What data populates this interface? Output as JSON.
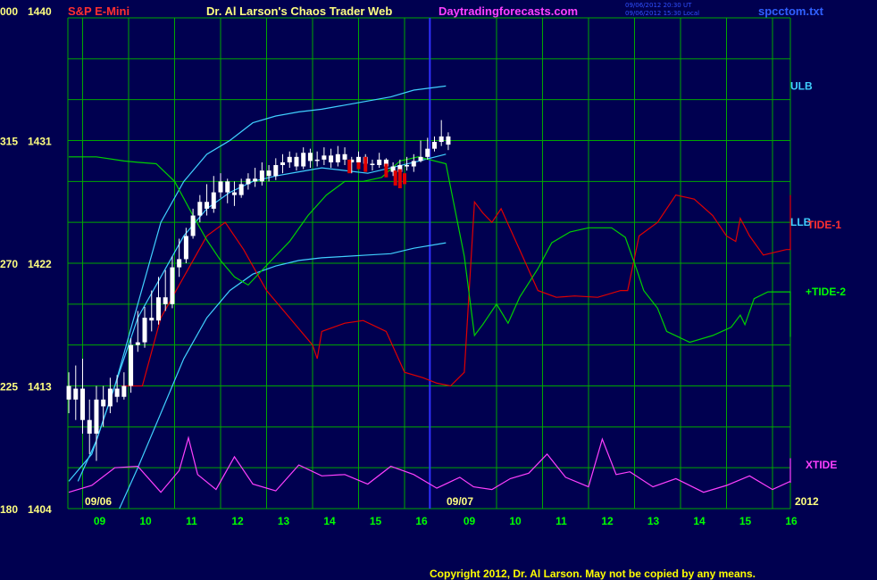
{
  "header": {
    "instrument": "S&P E-Mini",
    "title": "Dr. Al Larson's Chaos Trader Web",
    "website": "Daytradingforecasts.com",
    "stamp_line1": "09/06/2012 20:30 UT",
    "stamp_line2": "09/06/2012 15:30 Local",
    "file": "spcctom.txt"
  },
  "footer": {
    "copyright": "Copyright 2012, Dr. Al Larson. May not be copied by any means."
  },
  "colors": {
    "background": "#000050",
    "grid": "#00a800",
    "price": "#ffffff",
    "tide1": "#e00000",
    "tide2": "#00d000",
    "xtide": "#ff40ff",
    "bands": "#40d0ff",
    "day_divider": "#3030ff",
    "left_axis": "#ffff80",
    "hour_labels": "#00ff00"
  },
  "chart_data": {
    "type": "line",
    "title": "S&P E-Mini",
    "y_left_labels": [
      {
        "left": "000",
        "right": "1440"
      },
      {
        "left": "315",
        "right": "1431"
      },
      {
        "left": "270",
        "right": "1422"
      },
      {
        "left": "225",
        "right": "1413"
      },
      {
        "left": "180",
        "right": "1404"
      }
    ],
    "ylim": [
      1404,
      1440
    ],
    "x_hour_labels": [
      "09",
      "10",
      "11",
      "12",
      "13",
      "14",
      "15",
      "16",
      "09",
      "10",
      "11",
      "12",
      "13",
      "14",
      "15",
      "16"
    ],
    "date_labels": [
      "09/06",
      "09/07"
    ],
    "year_label": "2012",
    "series": [
      {
        "name": "ULB",
        "kind": "band-upper",
        "values": [
          [
            0,
            1406
          ],
          [
            0.5,
            1408
          ],
          [
            1,
            1413
          ],
          [
            1.5,
            1419
          ],
          [
            2,
            1425
          ],
          [
            2.5,
            1428
          ],
          [
            3,
            1430
          ],
          [
            3.5,
            1431
          ],
          [
            4,
            1432.3
          ],
          [
            4.5,
            1432.8
          ],
          [
            5,
            1433.1
          ],
          [
            5.5,
            1433.3
          ],
          [
            6,
            1433.6
          ],
          [
            6.5,
            1433.9
          ],
          [
            7,
            1434.2
          ],
          [
            7.5,
            1434.7
          ],
          [
            8.2,
            1435
          ]
        ]
      },
      {
        "name": "LLB",
        "kind": "band-lower",
        "values": [
          [
            1.1,
            1404
          ],
          [
            1.5,
            1407
          ],
          [
            2,
            1411
          ],
          [
            2.5,
            1415
          ],
          [
            3,
            1418
          ],
          [
            3.5,
            1420
          ],
          [
            4,
            1421.2
          ],
          [
            4.5,
            1421.8
          ],
          [
            5,
            1422.2
          ],
          [
            5.5,
            1422.4
          ],
          [
            6,
            1422.5
          ],
          [
            6.5,
            1422.6
          ],
          [
            7,
            1422.7
          ],
          [
            7.5,
            1423.1
          ],
          [
            8.2,
            1423.5
          ]
        ]
      },
      {
        "name": "mid-band",
        "kind": "band-mid",
        "values": [
          [
            0.2,
            1406
          ],
          [
            0.6,
            1409
          ],
          [
            1,
            1413
          ],
          [
            1.5,
            1418
          ],
          [
            2,
            1421
          ],
          [
            2.5,
            1424
          ],
          [
            3,
            1426
          ],
          [
            3.5,
            1427.2
          ],
          [
            4,
            1428
          ],
          [
            4.5,
            1428.4
          ],
          [
            5,
            1428.7
          ],
          [
            5.5,
            1429
          ],
          [
            6,
            1428.8
          ],
          [
            6.5,
            1428.6
          ],
          [
            7,
            1429
          ],
          [
            7.5,
            1429.4
          ],
          [
            8.2,
            1430
          ]
        ]
      },
      {
        "name": "TIDE-1",
        "values": [
          [
            1.15,
            1413
          ],
          [
            1.6,
            1413
          ],
          [
            2,
            1418
          ],
          [
            2.5,
            1421
          ],
          [
            3,
            1424
          ],
          [
            3.4,
            1425
          ],
          [
            3.8,
            1423
          ],
          [
            4.3,
            1420
          ],
          [
            4.8,
            1418
          ],
          [
            5.3,
            1416
          ],
          [
            5.4,
            1415
          ],
          [
            5.5,
            1417
          ],
          [
            6,
            1417.6
          ],
          [
            6.4,
            1417.8
          ],
          [
            6.9,
            1417
          ],
          [
            7.3,
            1414
          ],
          [
            7.7,
            1413.6
          ],
          [
            8.0,
            1413.2
          ],
          [
            8.3,
            1413
          ],
          [
            8.6,
            1414
          ],
          [
            8.82,
            1426.5
          ],
          [
            9,
            1425.7
          ],
          [
            9.2,
            1425
          ],
          [
            9.4,
            1426
          ],
          [
            9.8,
            1423
          ],
          [
            10.2,
            1420
          ],
          [
            10.6,
            1419.5
          ],
          [
            11,
            1419.6
          ],
          [
            11.5,
            1419.5
          ],
          [
            12,
            1420
          ],
          [
            12.15,
            1420
          ],
          [
            12.4,
            1424
          ],
          [
            12.8,
            1425
          ],
          [
            13.2,
            1427
          ],
          [
            13.6,
            1426.7
          ],
          [
            14,
            1425.5
          ],
          [
            14.3,
            1424
          ],
          [
            14.5,
            1423.6
          ],
          [
            14.6,
            1425.3
          ],
          [
            14.8,
            1424
          ],
          [
            15.1,
            1422.6
          ],
          [
            15.6,
            1423
          ],
          [
            16.2,
            1423
          ],
          [
            16.5,
            1423
          ],
          [
            16.7,
            1423.2
          ],
          [
            16.8,
            1425
          ],
          [
            17.3,
            1427
          ],
          [
            17.8,
            1425.3
          ]
        ]
      },
      {
        "name": "TIDE-2",
        "values": [
          [
            0,
            1429.8
          ],
          [
            0.6,
            1429.8
          ],
          [
            1.2,
            1429.5
          ],
          [
            1.5,
            1429.4
          ],
          [
            1.9,
            1429.3
          ],
          [
            2.3,
            1428
          ],
          [
            2.7,
            1425.5
          ],
          [
            3,
            1423.7
          ],
          [
            3.3,
            1422.2
          ],
          [
            3.6,
            1421
          ],
          [
            3.9,
            1420.4
          ],
          [
            4.4,
            1422.2
          ],
          [
            4.8,
            1423.6
          ],
          [
            5.2,
            1425.5
          ],
          [
            5.6,
            1427
          ],
          [
            6,
            1428
          ],
          [
            6.4,
            1428
          ],
          [
            6.8,
            1428.3
          ],
          [
            7.2,
            1429.5
          ],
          [
            7.6,
            1429.8
          ],
          [
            8.2,
            1429.3
          ],
          [
            8.6,
            1422.5
          ],
          [
            8.82,
            1416.7
          ],
          [
            9,
            1417.5
          ],
          [
            9.3,
            1419
          ],
          [
            9.55,
            1417.6
          ],
          [
            9.8,
            1419.5
          ],
          [
            10.2,
            1421.6
          ],
          [
            10.5,
            1423.5
          ],
          [
            10.9,
            1424.3
          ],
          [
            11.3,
            1424.6
          ],
          [
            11.8,
            1424.6
          ],
          [
            12.1,
            1423.9
          ],
          [
            12.35,
            1421.5
          ],
          [
            12.5,
            1420
          ],
          [
            12.8,
            1418.7
          ],
          [
            13,
            1417
          ],
          [
            13.5,
            1416.2
          ],
          [
            14,
            1416.7
          ],
          [
            14.4,
            1417.3
          ],
          [
            14.6,
            1418.2
          ],
          [
            14.7,
            1417.5
          ],
          [
            14.9,
            1419.4
          ],
          [
            15.2,
            1419.9
          ],
          [
            15.8,
            1419.9
          ],
          [
            16.2,
            1419.8
          ],
          [
            16.3,
            1417.6
          ],
          [
            16.6,
            1416.6
          ],
          [
            17,
            1417
          ],
          [
            17.4,
            1418.1
          ]
        ]
      },
      {
        "name": "XTIDE",
        "kind": "oscillator-plotted-on-same-scale",
        "values": [
          [
            0,
            1405.2
          ],
          [
            0.5,
            1405.7
          ],
          [
            1,
            1407
          ],
          [
            1.5,
            1407.1
          ],
          [
            2,
            1405.2
          ],
          [
            2.4,
            1406.8
          ],
          [
            2.6,
            1409.2
          ],
          [
            2.8,
            1406.5
          ],
          [
            3.2,
            1405.4
          ],
          [
            3.6,
            1407.8
          ],
          [
            4,
            1405.8
          ],
          [
            4.5,
            1405.3
          ],
          [
            5,
            1407.2
          ],
          [
            5.5,
            1406.4
          ],
          [
            6,
            1406.5
          ],
          [
            6.5,
            1405.8
          ],
          [
            7,
            1407.1
          ],
          [
            7.5,
            1406.5
          ],
          [
            8,
            1405.5
          ],
          [
            8.5,
            1406.3
          ],
          [
            8.8,
            1405.6
          ],
          [
            9.2,
            1405.4
          ],
          [
            9.6,
            1406.2
          ],
          [
            10,
            1406.6
          ],
          [
            10.4,
            1408
          ],
          [
            10.8,
            1406.3
          ],
          [
            11.3,
            1405.6
          ],
          [
            11.6,
            1409.1
          ],
          [
            11.9,
            1406.5
          ],
          [
            12.2,
            1406.7
          ],
          [
            12.7,
            1405.6
          ],
          [
            13.2,
            1406.2
          ],
          [
            13.8,
            1405.2
          ],
          [
            14.3,
            1405.7
          ],
          [
            14.8,
            1406.4
          ],
          [
            15.3,
            1405.4
          ],
          [
            15.8,
            1406
          ],
          [
            16.2,
            1407.7
          ],
          [
            16.6,
            1405.9
          ],
          [
            17,
            1406.5
          ],
          [
            17.4,
            1407
          ]
        ]
      }
    ],
    "price_bars": [
      [
        0,
        1413,
        1412,
        1414,
        1411
      ],
      [
        0.15,
        1412,
        1412.8,
        1414.5,
        1410.5
      ],
      [
        0.3,
        1412.8,
        1410.5,
        1415,
        1409.5
      ],
      [
        0.45,
        1410.5,
        1409.5,
        1412,
        1408
      ],
      [
        0.6,
        1409.5,
        1412,
        1413,
        1407.5
      ],
      [
        0.75,
        1412,
        1411.5,
        1413,
        1410
      ],
      [
        0.9,
        1411.5,
        1412.8,
        1413.6,
        1411
      ],
      [
        1.05,
        1412.8,
        1412.2,
        1413.8,
        1411.8
      ],
      [
        1.2,
        1412.2,
        1413,
        1414,
        1412
      ],
      [
        1.35,
        1413,
        1416,
        1416.5,
        1412.5
      ],
      [
        1.5,
        1416,
        1416.2,
        1418.5,
        1415.5
      ],
      [
        1.65,
        1416.2,
        1418,
        1418.8,
        1415.8
      ],
      [
        1.8,
        1418,
        1417.8,
        1420,
        1417
      ],
      [
        1.95,
        1417.8,
        1419.5,
        1421,
        1417.5
      ],
      [
        2.1,
        1419.5,
        1419,
        1421.5,
        1418.5
      ],
      [
        2.25,
        1419,
        1421.7,
        1422.5,
        1418.7
      ],
      [
        2.4,
        1421.7,
        1422.3,
        1423.8,
        1421
      ],
      [
        2.55,
        1422.3,
        1424,
        1424.6,
        1422
      ],
      [
        2.7,
        1424,
        1425.5,
        1426,
        1423.8
      ],
      [
        2.85,
        1425.5,
        1426.5,
        1427,
        1425
      ],
      [
        3.0,
        1426.5,
        1426,
        1427.8,
        1425.5
      ],
      [
        3.15,
        1426,
        1427.2,
        1428.4,
        1425.7
      ],
      [
        3.3,
        1427.2,
        1428,
        1428.6,
        1426.8
      ],
      [
        3.45,
        1428,
        1427.2,
        1428.2,
        1426.4
      ],
      [
        3.6,
        1427.2,
        1427,
        1428,
        1426.2
      ],
      [
        3.75,
        1427,
        1427.8,
        1428.2,
        1426.8
      ],
      [
        3.9,
        1427.8,
        1428.2,
        1428.6,
        1427.4
      ],
      [
        4.05,
        1428.2,
        1428,
        1429,
        1427.6
      ],
      [
        4.2,
        1428,
        1428.8,
        1429.4,
        1427.7
      ],
      [
        4.35,
        1428.8,
        1428.4,
        1429.2,
        1428
      ],
      [
        4.5,
        1428.4,
        1429.2,
        1429.7,
        1428.1
      ],
      [
        4.65,
        1429.2,
        1429.4,
        1430,
        1428.6
      ],
      [
        4.8,
        1429.4,
        1429.8,
        1430.2,
        1429
      ],
      [
        4.95,
        1429.8,
        1429.1,
        1430.1,
        1428.8
      ],
      [
        5.1,
        1429.1,
        1430.1,
        1430.5,
        1428.9
      ],
      [
        5.25,
        1430.1,
        1429.5,
        1430.4,
        1429
      ],
      [
        5.4,
        1429.5,
        1429.6,
        1430.2,
        1429.1
      ],
      [
        5.55,
        1429.6,
        1429.9,
        1430.5,
        1429.2
      ],
      [
        5.7,
        1429.9,
        1429.4,
        1430.4,
        1429
      ],
      [
        5.85,
        1429.4,
        1430,
        1430.6,
        1429.1
      ],
      [
        6.0,
        1430,
        1429.6,
        1430.5,
        1429.2
      ],
      [
        6.15,
        1429.6,
        1429.4,
        1429.8,
        1428.6
      ],
      [
        6.3,
        1429.4,
        1429.8,
        1430.2,
        1429
      ],
      [
        6.45,
        1429.8,
        1429.3,
        1430,
        1428.9
      ],
      [
        6.6,
        1429.3,
        1429.2,
        1429.6,
        1428.8
      ],
      [
        6.75,
        1429.2,
        1429.6,
        1430.1,
        1429
      ],
      [
        6.9,
        1429.6,
        1429.1,
        1429.7,
        1428.6
      ],
      [
        7.05,
        1429.1,
        1428.7,
        1429.4,
        1428.4
      ],
      [
        7.2,
        1428.7,
        1429.2,
        1429.6,
        1428.5
      ],
      [
        7.35,
        1429.2,
        1429.1,
        1429.8,
        1428.8
      ],
      [
        7.5,
        1429.1,
        1429.5,
        1430,
        1428.7
      ],
      [
        7.65,
        1429.5,
        1429.8,
        1431,
        1429.4
      ],
      [
        7.8,
        1429.8,
        1430.4,
        1431.2,
        1429.6
      ],
      [
        7.95,
        1430.4,
        1430.9,
        1431.3,
        1430.2
      ],
      [
        8.1,
        1430.9,
        1431.3,
        1432.5,
        1430.6
      ],
      [
        8.25,
        1431.3,
        1430.7,
        1431.6,
        1430.3
      ]
    ],
    "red_bars": [
      [
        6.1,
        1429.6,
        1428.6
      ],
      [
        6.3,
        1429.4,
        1428.9
      ],
      [
        6.45,
        1429.8,
        1428.7
      ],
      [
        6.9,
        1429.3,
        1428.3
      ],
      [
        7.1,
        1428.8,
        1427.7
      ],
      [
        7.2,
        1428.9,
        1427.5
      ],
      [
        7.3,
        1428.6,
        1427.8
      ]
    ],
    "right_labels": [
      {
        "text": "ULB",
        "color": "#40d0ff",
        "value": 1435
      },
      {
        "text": "LLB",
        "color": "#40d0ff",
        "value": 1425
      },
      {
        "text": "TIDE-1",
        "color": "#ff3030",
        "value": 1424.8
      },
      {
        "text": "+TIDE-2",
        "color": "#00ff00",
        "value": 1419.9
      },
      {
        "text": "XTIDE",
        "color": "#ff40ff",
        "value": 1407.2
      }
    ]
  }
}
